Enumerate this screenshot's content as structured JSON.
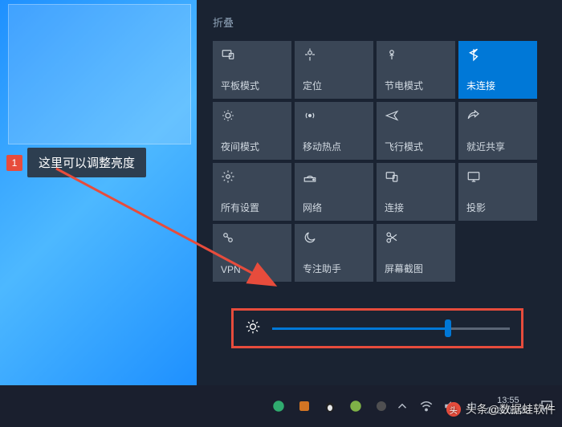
{
  "callout": {
    "num": "1",
    "text": "这里可以调整亮度"
  },
  "actionCenter": {
    "collapse": "折叠",
    "tiles": [
      {
        "label": "平板模式",
        "icon": "tablet"
      },
      {
        "label": "定位",
        "icon": "location"
      },
      {
        "label": "节电模式",
        "icon": "battery"
      },
      {
        "label": "未连接",
        "icon": "bluetooth",
        "active": true
      },
      {
        "label": "夜间模式",
        "icon": "night"
      },
      {
        "label": "移动热点",
        "icon": "hotspot"
      },
      {
        "label": "飞行模式",
        "icon": "airplane"
      },
      {
        "label": "就近共享",
        "icon": "share"
      },
      {
        "label": "所有设置",
        "icon": "settings"
      },
      {
        "label": "网络",
        "icon": "network"
      },
      {
        "label": "连接",
        "icon": "connect"
      },
      {
        "label": "投影",
        "icon": "project"
      },
      {
        "label": "VPN",
        "icon": "vpn"
      },
      {
        "label": "专注助手",
        "icon": "moon"
      },
      {
        "label": "屏幕截图",
        "icon": "snip"
      }
    ],
    "brightness": 74
  },
  "taskbar": {
    "time": "13:55",
    "date": "2022/11/22"
  },
  "watermark": "头条@数据蛙软件"
}
